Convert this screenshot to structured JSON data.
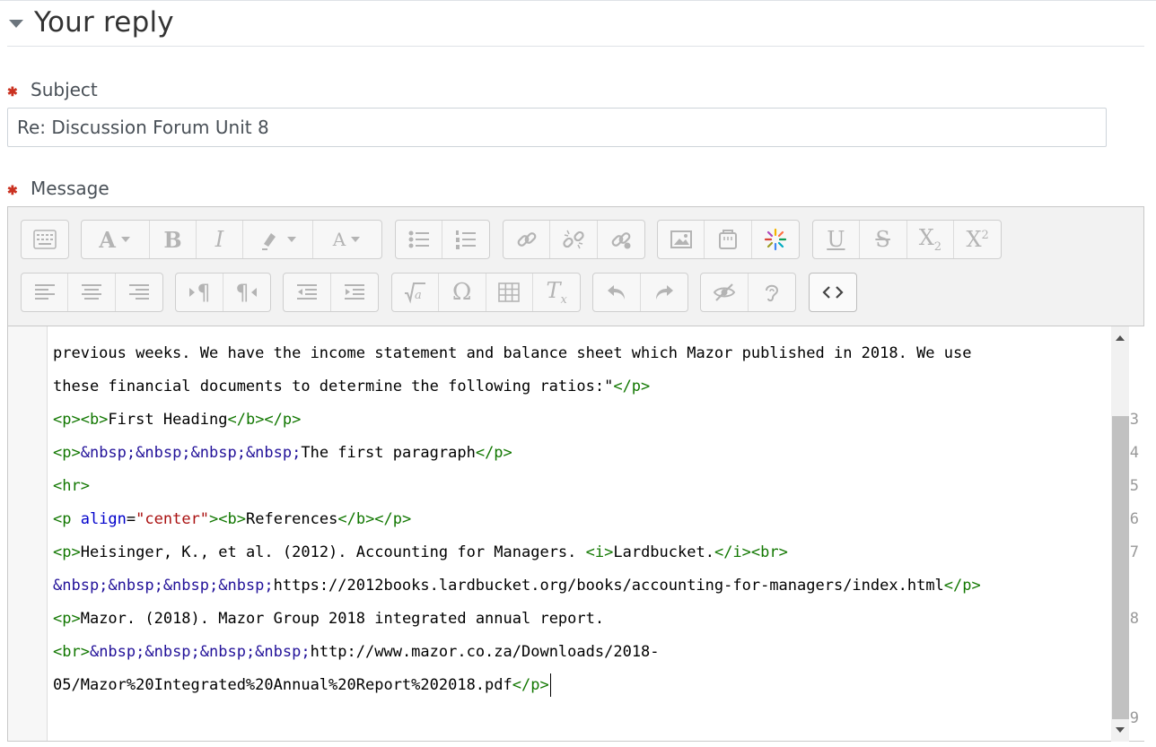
{
  "section": {
    "title": "Your reply"
  },
  "subject": {
    "label": "Subject",
    "required_marker": "✱",
    "value": "Re: Discussion Forum Unit 8"
  },
  "message": {
    "label": "Message",
    "required_marker": "✱"
  },
  "toolbar": {
    "rows": [
      [
        [
          "toggle-toolbar-icon"
        ],
        [
          "font-style-icon",
          "bold-icon",
          "italic-icon",
          "highlight-color-icon",
          "font-color-icon"
        ],
        [
          "bulleted-list-icon",
          "numbered-list-icon"
        ],
        [
          "link-icon",
          "unlink-icon",
          "manage-links-icon"
        ],
        [
          "image-icon",
          "media-icon",
          "recordrtc-icon"
        ],
        [
          "underline-icon",
          "strikethrough-icon",
          "subscript-icon",
          "superscript-icon"
        ]
      ],
      [
        [
          "align-left-icon",
          "align-center-icon",
          "align-right-icon"
        ],
        [
          "ltr-icon",
          "rtl-icon"
        ],
        [
          "outdent-icon",
          "indent-icon"
        ],
        [
          "equation-icon",
          "special-character-icon",
          "table-icon",
          "clear-formatting-icon"
        ],
        [
          "undo-icon",
          "redo-icon"
        ],
        [
          "accessibility-checker-icon",
          "screenreader-helper-icon"
        ],
        [
          "html-source-icon"
        ]
      ]
    ]
  },
  "editor": {
    "line_numbers": [
      "3",
      "4",
      "5",
      "6",
      "7",
      "8",
      "9"
    ],
    "lines": [
      [
        {
          "t": "txt",
          "v": "previous weeks. We have the income statement and balance sheet which Mazor published in 2018. We use"
        }
      ],
      [
        {
          "t": "txt",
          "v": "these financial documents to determine the following ratios:\""
        },
        {
          "t": "tag",
          "v": "</p>"
        }
      ],
      [
        {
          "t": "tag",
          "v": "<p><b>"
        },
        {
          "t": "txt",
          "v": "First Heading"
        },
        {
          "t": "tag",
          "v": "</b></p>"
        }
      ],
      [
        {
          "t": "tag",
          "v": "<p>"
        },
        {
          "t": "ent",
          "v": "&nbsp;&nbsp;&nbsp;&nbsp;"
        },
        {
          "t": "txt",
          "v": "The first paragraph"
        },
        {
          "t": "tag",
          "v": "</p>"
        }
      ],
      [
        {
          "t": "tag",
          "v": "<hr>"
        }
      ],
      [
        {
          "t": "tag",
          "v": "<p "
        },
        {
          "t": "attr",
          "v": "align"
        },
        {
          "t": "txt",
          "v": "="
        },
        {
          "t": "str",
          "v": "\"center\""
        },
        {
          "t": "tag",
          "v": "><b>"
        },
        {
          "t": "txt",
          "v": "References"
        },
        {
          "t": "tag",
          "v": "</b></p>"
        }
      ],
      [
        {
          "t": "tag",
          "v": "<p>"
        },
        {
          "t": "txt",
          "v": "Heisinger, K., et al. (2012). Accounting for Managers. "
        },
        {
          "t": "tag",
          "v": "<i>"
        },
        {
          "t": "txt",
          "v": "Lardbucket."
        },
        {
          "t": "tag",
          "v": "</i><br>"
        }
      ],
      [
        {
          "t": "ent",
          "v": "&nbsp;&nbsp;&nbsp;&nbsp;"
        },
        {
          "t": "txt",
          "v": "https://2012books.lardbucket.org/books/accounting-for-managers/index.html"
        },
        {
          "t": "tag",
          "v": "</p>"
        }
      ],
      [
        {
          "t": "tag",
          "v": "<p>"
        },
        {
          "t": "txt",
          "v": "Mazor. (2018). Mazor Group 2018 integrated annual report."
        }
      ],
      [
        {
          "t": "tag",
          "v": "<br>"
        },
        {
          "t": "ent",
          "v": "&nbsp;&nbsp;&nbsp;&nbsp;"
        },
        {
          "t": "txt",
          "v": "http://www.mazor.co.za/Downloads/2018-"
        }
      ],
      [
        {
          "t": "txt",
          "v": "05/Mazor%20Integrated%20Annual%20Report%202018.pdf"
        },
        {
          "t": "tag",
          "v": "</p>"
        }
      ]
    ]
  }
}
